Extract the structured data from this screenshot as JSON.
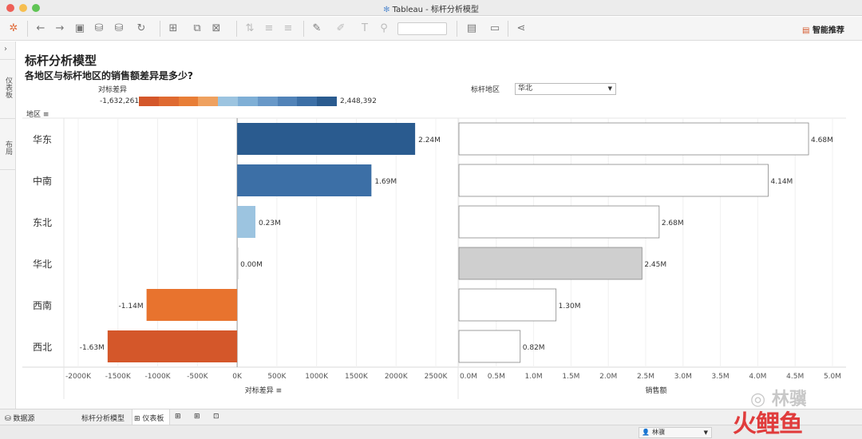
{
  "window": {
    "title": "Tableau - 标杆分析模型",
    "traffic_colors": [
      "#ee5f57",
      "#f6be4f",
      "#5fc454"
    ]
  },
  "toolbar": {
    "smart_recommend": "智能推荐"
  },
  "sidebar": {
    "dashboard_label": "仪表板",
    "layout_label": "布局",
    "collapse_icon": "chevron-right-icon"
  },
  "sheet": {
    "title": "标杆分析模型",
    "subtitle": "各地区与标杆地区的销售额差异是多少?",
    "region_header": "地区",
    "legend": {
      "title": "对标差异",
      "min_label": "-1,632,261",
      "max_label": "2,448,392",
      "colors": [
        "#d4572a",
        "#df6a31",
        "#e87e37",
        "#efa15f",
        "#9cc4e0",
        "#7fafd6",
        "#6898c8",
        "#5183b8",
        "#3c6fa6",
        "#2a5b8f"
      ]
    },
    "benchmark": {
      "label": "标杆地区",
      "value": "华北"
    }
  },
  "chart_data": [
    {
      "type": "bar",
      "orientation": "horizontal",
      "categories": [
        "华东",
        "中南",
        "东北",
        "华北",
        "西南",
        "西北"
      ],
      "values": [
        2240000,
        1690000,
        230000,
        0,
        -1140000,
        -1630000
      ],
      "data_labels": [
        "2.24M",
        "1.69M",
        "0.23M",
        "0.00M",
        "-1.14M",
        "-1.63M"
      ],
      "colors": [
        "#2a5b8f",
        "#3c6fa6",
        "#9cc4e0",
        "#c9c9c9",
        "#e8732e",
        "#d4572a"
      ],
      "xlabel": "对标差异",
      "xlim": [
        -2000000,
        2500000
      ],
      "ticks": [
        -2000000,
        -1500000,
        -1000000,
        -500000,
        0,
        500000,
        1000000,
        1500000,
        2000000,
        2500000
      ],
      "tick_labels": [
        "-2000K",
        "-1500K",
        "-1000K",
        "-500K",
        "0K",
        "500K",
        "1000K",
        "1500K",
        "2000K",
        "2500K"
      ],
      "grid": true
    },
    {
      "type": "bar",
      "orientation": "horizontal",
      "categories": [
        "华东",
        "中南",
        "东北",
        "华北",
        "西南",
        "西北"
      ],
      "values": [
        4680000,
        4140000,
        2680000,
        2450000,
        1300000,
        820000
      ],
      "data_labels": [
        "4.68M",
        "4.14M",
        "2.68M",
        "2.45M",
        "1.30M",
        "0.82M"
      ],
      "highlight": "华北",
      "highlight_color": "#cfcfcf",
      "xlabel": "销售额",
      "xlim": [
        0,
        5000000
      ],
      "ticks": [
        0,
        500000,
        1000000,
        1500000,
        2000000,
        2500000,
        3000000,
        3500000,
        4000000,
        4500000,
        5000000
      ],
      "tick_labels": [
        "0.0M",
        "0.5M",
        "1.0M",
        "1.5M",
        "2.0M",
        "2.5M",
        "3.0M",
        "3.5M",
        "4.0M",
        "4.5M",
        "5.0M"
      ],
      "grid": true
    }
  ],
  "bottom_tabs": {
    "datasource": "数据源",
    "sheet_tab": "标杆分析模型",
    "dashboard_tab": "仪表板"
  },
  "status": {
    "user": "林骥"
  },
  "watermark": {
    "name": "林骥",
    "brand": "火鲤鱼"
  }
}
